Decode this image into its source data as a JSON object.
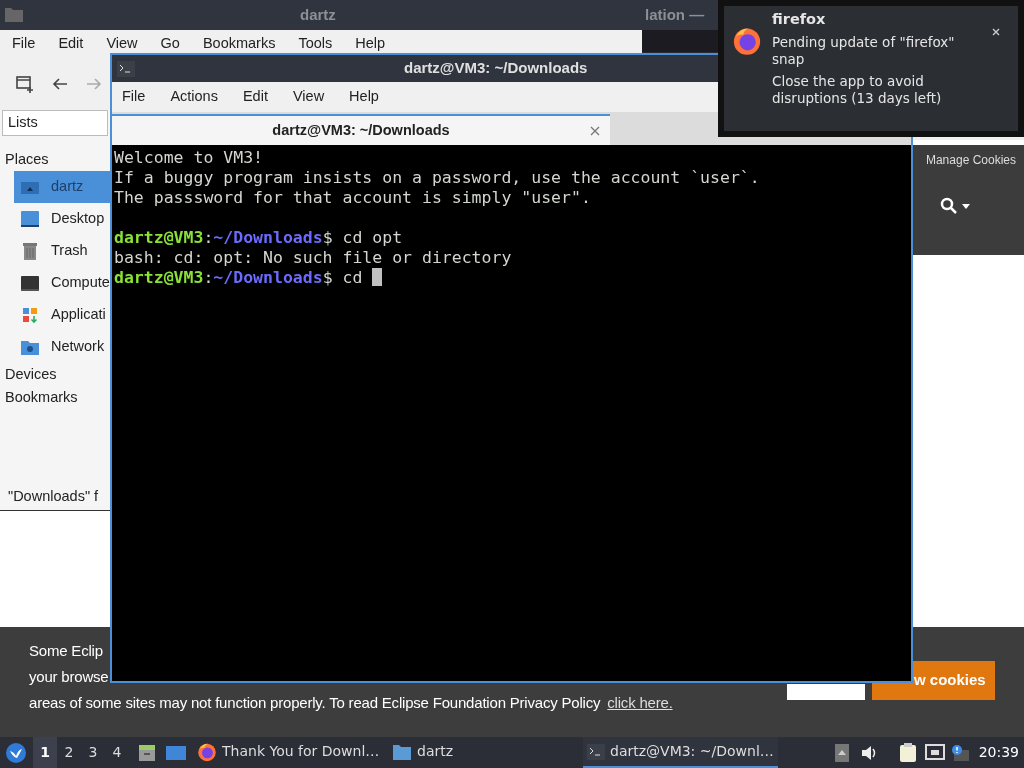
{
  "browser": {
    "title": "lation —",
    "site_header": {
      "link": "Manage Cookies"
    },
    "cookie_banner": {
      "lines": [
        "Some Eclip",
        "your browse"
      ],
      "last_line": "areas of some sites may not function properly. To read Eclipse Foundation Privacy Policy",
      "link": "click here.",
      "accept_button": "w cookies"
    }
  },
  "file_manager": {
    "title": "dartz",
    "menu": [
      "File",
      "Edit",
      "View",
      "Go",
      "Bookmarks",
      "Tools",
      "Help"
    ],
    "sidebar_mode": "Lists",
    "sections": [
      {
        "label": "Places",
        "items": [
          {
            "label": "dartz",
            "kind": "home",
            "selected": true
          },
          {
            "label": "Desktop",
            "kind": "desktop",
            "selected": false
          },
          {
            "label": "Trash",
            "kind": "trash",
            "selected": false
          },
          {
            "label": "Compute",
            "kind": "computer",
            "selected": false
          },
          {
            "label": "Applicati",
            "kind": "apps",
            "selected": false
          },
          {
            "label": "Network",
            "kind": "network",
            "selected": false
          }
        ]
      },
      {
        "label": "Devices"
      },
      {
        "label": "Bookmarks"
      }
    ],
    "status": "\"Downloads\" f"
  },
  "terminal": {
    "title": "dartz@VM3: ~/Downloads",
    "menu": [
      "File",
      "Actions",
      "Edit",
      "View",
      "Help"
    ],
    "tabs": [
      {
        "label": "dartz@VM3: ~/Downloads",
        "selected": true
      }
    ],
    "lines": [
      {
        "kind": "text",
        "text": "Welcome to VM3!"
      },
      {
        "kind": "text",
        "text": "If a buggy program insists on a password, use the account `user`."
      },
      {
        "kind": "text",
        "text": "The passsword for that account is simply \"user\"."
      },
      {
        "kind": "blank"
      },
      {
        "kind": "prompt",
        "user": "dartz@VM3",
        "separator": ":",
        "path": "~/Downloads",
        "sign": "$",
        "command": "cd opt",
        "cursor": false
      },
      {
        "kind": "text",
        "text": "bash: cd: opt: No such file or directory"
      },
      {
        "kind": "prompt",
        "user": "dartz@VM3",
        "separator": ":",
        "path": "~/Downloads",
        "sign": "$",
        "command": "cd",
        "cursor": true
      }
    ]
  },
  "notification": {
    "app": "firefox",
    "body": [
      "Pending update of \"firefox\" snap",
      "Close the app to avoid disruptions (13 days left)"
    ]
  },
  "taskbar": {
    "workspaces": [
      {
        "label": "1",
        "selected": true
      },
      {
        "label": "2",
        "selected": false
      },
      {
        "label": "3",
        "selected": false
      },
      {
        "label": "4",
        "selected": false
      }
    ],
    "tasks": [
      {
        "label": "Thank You for Downl…",
        "kind": "browser",
        "selected": false
      },
      {
        "label": "dartz",
        "kind": "folder",
        "selected": false
      },
      {
        "label": "dartz@VM3: ~/Downl…",
        "kind": "terminal",
        "selected": true
      }
    ],
    "clock": "20:39"
  }
}
